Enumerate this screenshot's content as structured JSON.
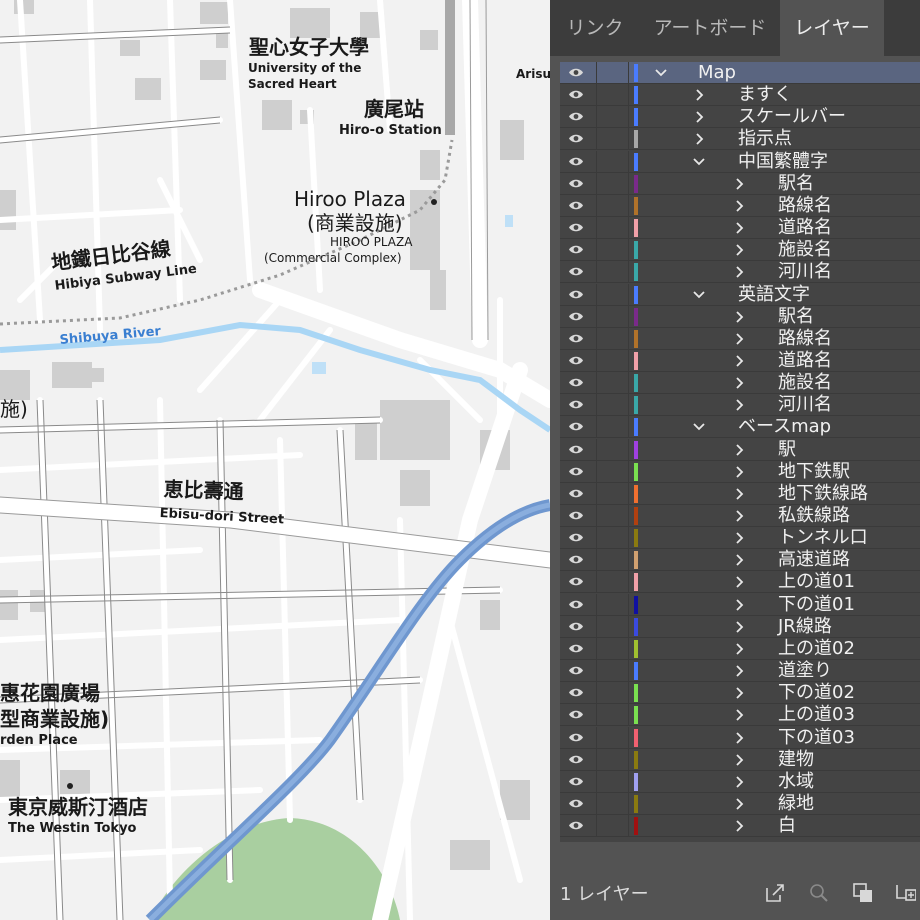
{
  "map": {
    "labels": [
      {
        "id": "seishin-jp",
        "text": "聖心女子大學"
      },
      {
        "id": "seishin-en1",
        "text": "University of the"
      },
      {
        "id": "seishin-en2",
        "text": "Sacred Heart"
      },
      {
        "id": "hiroo-station-jp",
        "text": "廣尾站"
      },
      {
        "id": "hiroo-station-en",
        "text": "Hiro-o Station"
      },
      {
        "id": "arisu",
        "text": "Arisu"
      },
      {
        "id": "hiroo-plaza-1",
        "text": "Hiroo Plaza"
      },
      {
        "id": "hiroo-plaza-2",
        "text": "(商業設施)"
      },
      {
        "id": "hiroo-plaza-en1",
        "text": "HIROO PLAZA"
      },
      {
        "id": "hiroo-plaza-en2",
        "text": "(Commercial Complex)"
      },
      {
        "id": "hibiya-jp",
        "text": "地鐵日比谷線"
      },
      {
        "id": "hibiya-en",
        "text": "Hibiya Subway Line"
      },
      {
        "id": "shibuya-river",
        "text": "Shibuya River"
      },
      {
        "id": "partial-shi",
        "text": "施)"
      },
      {
        "id": "ebisu-jp",
        "text": "恵比壽通"
      },
      {
        "id": "ebisu-en",
        "text": "Ebisu-dori Street"
      },
      {
        "id": "garden-1",
        "text": "惠花園廣場"
      },
      {
        "id": "garden-2",
        "text": "型商業設施)"
      },
      {
        "id": "garden-en",
        "text": "rden Place"
      },
      {
        "id": "westin-jp",
        "text": "東京威斯汀酒店"
      },
      {
        "id": "westin-en",
        "text": "The Westin Tokyo"
      }
    ]
  },
  "panel": {
    "tabs": [
      {
        "label": "リンク",
        "active": false
      },
      {
        "label": "アートボード",
        "active": false
      },
      {
        "label": "レイヤー",
        "active": true
      }
    ],
    "layers": [
      {
        "name": "Map",
        "level": 0,
        "expanded": true,
        "color": "#4a7cff",
        "selected": true
      },
      {
        "name": "ますく",
        "level": 1,
        "expanded": false,
        "color": "#4a7cff"
      },
      {
        "name": "スケールバー",
        "level": 1,
        "expanded": false,
        "color": "#4a7cff"
      },
      {
        "name": "指示点",
        "level": 1,
        "expanded": false,
        "color": "#a8a8a8"
      },
      {
        "name": "中国繁體字",
        "level": 1,
        "expanded": true,
        "color": "#4a7cff"
      },
      {
        "name": "駅名",
        "level": 2,
        "expanded": false,
        "color": "#7a2a8a"
      },
      {
        "name": "路線名",
        "level": 2,
        "expanded": false,
        "color": "#b0722a"
      },
      {
        "name": "道路名",
        "level": 2,
        "expanded": false,
        "color": "#f0a0a8"
      },
      {
        "name": "施設名",
        "level": 2,
        "expanded": false,
        "color": "#3aa8a8"
      },
      {
        "name": "河川名",
        "level": 2,
        "expanded": false,
        "color": "#3aa8a8"
      },
      {
        "name": "英語文字",
        "level": 1,
        "expanded": true,
        "color": "#4a7cff"
      },
      {
        "name": "駅名",
        "level": 2,
        "expanded": false,
        "color": "#7a2a8a"
      },
      {
        "name": "路線名",
        "level": 2,
        "expanded": false,
        "color": "#b0722a"
      },
      {
        "name": "道路名",
        "level": 2,
        "expanded": false,
        "color": "#f0a0a8"
      },
      {
        "name": "施設名",
        "level": 2,
        "expanded": false,
        "color": "#3aa8a8"
      },
      {
        "name": "河川名",
        "level": 2,
        "expanded": false,
        "color": "#3aa8a8"
      },
      {
        "name": "ベースmap",
        "level": 1,
        "expanded": true,
        "color": "#4a7cff"
      },
      {
        "name": "駅",
        "level": 2,
        "expanded": false,
        "color": "#a040e0"
      },
      {
        "name": "地下鉄駅",
        "level": 2,
        "expanded": false,
        "color": "#7ae050"
      },
      {
        "name": "地下鉄線路",
        "level": 2,
        "expanded": false,
        "color": "#f07030"
      },
      {
        "name": "私鉄線路",
        "level": 2,
        "expanded": false,
        "color": "#b04010"
      },
      {
        "name": "トンネル口",
        "level": 2,
        "expanded": false,
        "color": "#8a7a10"
      },
      {
        "name": "高速道路",
        "level": 2,
        "expanded": false,
        "color": "#d0a070"
      },
      {
        "name": "上の道01",
        "level": 2,
        "expanded": false,
        "color": "#f0a0a8"
      },
      {
        "name": "下の道01",
        "level": 2,
        "expanded": false,
        "color": "#1010a0"
      },
      {
        "name": "JR線路",
        "level": 2,
        "expanded": false,
        "color": "#3a4ae0"
      },
      {
        "name": "上の道02",
        "level": 2,
        "expanded": false,
        "color": "#a0c030"
      },
      {
        "name": "道塗り",
        "level": 2,
        "expanded": false,
        "color": "#4a7cff"
      },
      {
        "name": "下の道02",
        "level": 2,
        "expanded": false,
        "color": "#7ae050"
      },
      {
        "name": "上の道03",
        "level": 2,
        "expanded": false,
        "color": "#7ae050"
      },
      {
        "name": "下の道03",
        "level": 2,
        "expanded": false,
        "color": "#f06070"
      },
      {
        "name": "建物",
        "level": 2,
        "expanded": false,
        "color": "#8a7a10"
      },
      {
        "name": "水域",
        "level": 2,
        "expanded": false,
        "color": "#a0a0f0"
      },
      {
        "name": "緑地",
        "level": 2,
        "expanded": false,
        "color": "#8a7a10"
      },
      {
        "name": "白",
        "level": 2,
        "expanded": false,
        "color": "#a01010"
      }
    ],
    "footer": {
      "count_label": "1 レイヤー",
      "icons": [
        "export-icon",
        "search-icon",
        "clipping-mask-icon",
        "new-sublayer-icon"
      ]
    }
  }
}
